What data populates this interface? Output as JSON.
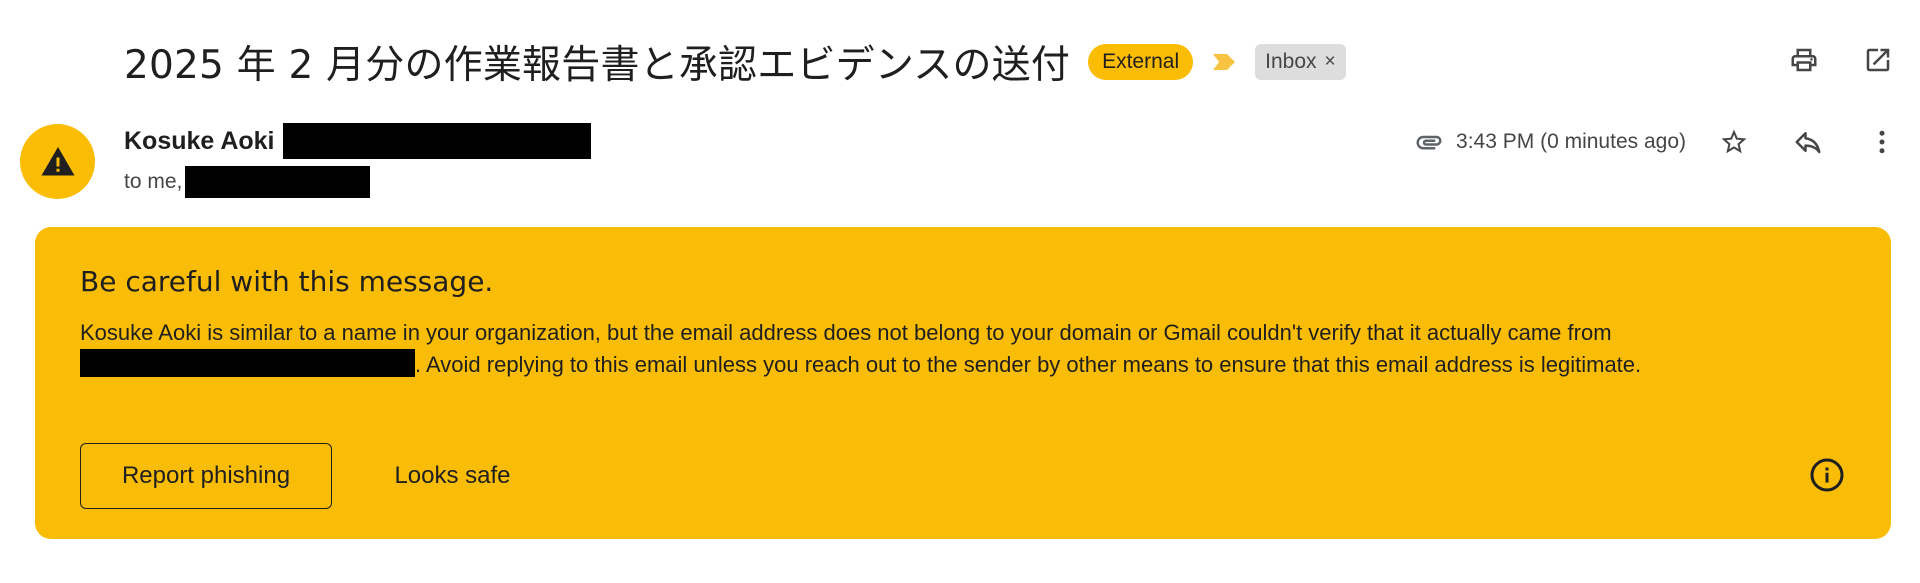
{
  "email": {
    "subject": "2025 年 2 月分の作業報告書と承認エビデンスの送付",
    "labels": {
      "external": "External",
      "inbox": "Inbox",
      "inbox_remove": "×"
    },
    "sender": {
      "name": "Kosuke Aoki",
      "to_prefix": "to me,"
    },
    "timestamp": "3:43 PM (0 minutes ago)"
  },
  "warning": {
    "title": "Be careful with this message.",
    "body_part1": "Kosuke Aoki is similar to a name in your organization, but the email address does not belong to your domain or Gmail couldn't verify that it actually came from ",
    "body_part2": ". Avoid replying to this email unless you reach out to the sender by other means to ensure that this email address is legitimate.",
    "report_button": "Report phishing",
    "safe_button": "Looks safe"
  },
  "icons": {
    "print": "print-icon",
    "open_new_window": "open-in-new-icon",
    "attachment": "paperclip-icon",
    "star": "star-icon",
    "reply": "reply-icon",
    "more": "more-vertical-icon",
    "warning": "warning-triangle-icon",
    "info": "info-icon",
    "important": "important-marker-icon"
  },
  "colors": {
    "warning_banner": "#f9bc07",
    "external_label": "#fbbc04",
    "avatar": "#fbbc04",
    "inbox_label": "#dddddd"
  }
}
